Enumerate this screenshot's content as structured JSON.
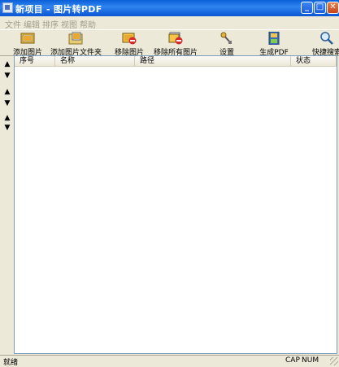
{
  "window": {
    "title": "新项目 - 图片转PDF"
  },
  "menu": [
    "文件",
    "编辑",
    "排序",
    "视图",
    "帮助"
  ],
  "toolbar": [
    {
      "label": "添加图片",
      "icon": "add-image-icon"
    },
    {
      "label": "添加图片文件夹",
      "icon": "add-folder-icon"
    },
    {
      "label": "移除图片",
      "icon": "remove-image-icon"
    },
    {
      "label": "移除所有图片",
      "icon": "remove-all-icon"
    },
    {
      "label": "设置",
      "icon": "settings-icon"
    },
    {
      "label": "生成PDF",
      "icon": "generate-pdf-icon"
    },
    {
      "label": "快捷搜索",
      "icon": "quick-search-icon"
    }
  ],
  "sidebar": [
    "▲",
    "▼",
    "▲",
    "▼",
    "▲",
    "▼"
  ],
  "columns": [
    "序号",
    "名称",
    "路径",
    "状态"
  ],
  "status": {
    "text": "就绪",
    "cap": "CAP",
    "num": "NUM"
  },
  "colors": {
    "title_bar": "#0a5fd8",
    "window_bg": "#ece9d8",
    "list_bg": "#ffffff"
  }
}
